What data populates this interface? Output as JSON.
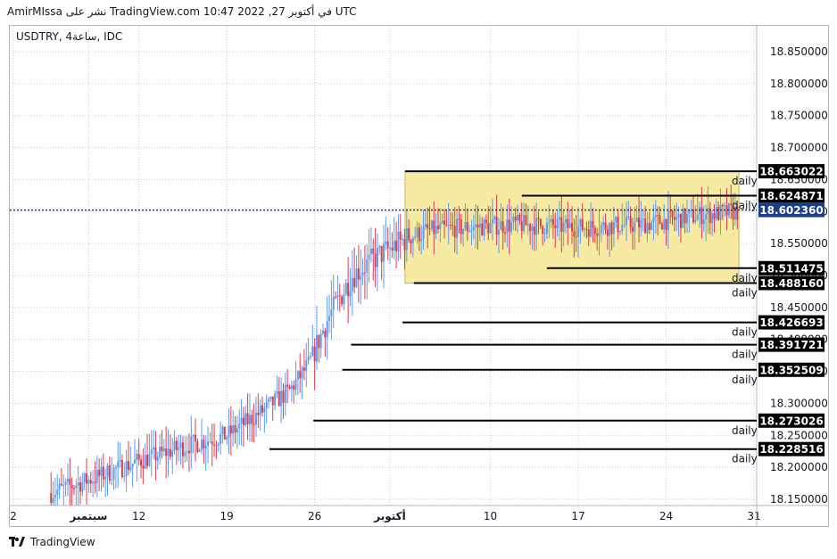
{
  "caption": "AmirMIssa نشر على TradingView.com في أكتوبر 27, 2022 10:47 UTC",
  "legend": "USDTRY, 4ساعة, IDC",
  "brand": "TradingView",
  "colors": {
    "up": "#5b9cf6",
    "down": "#e03a4d",
    "zone_fill": "#f7eaa2",
    "zone_border": "#c9b84f",
    "level_line": "#000000",
    "current_box": "#1b3e86",
    "grid": "#c5cad6"
  },
  "chart_data": {
    "type": "candlestick",
    "symbol": "USDTRY",
    "timeframe": "4ساعة",
    "source": "IDC",
    "y_axis": {
      "range": [
        18.15,
        18.88
      ],
      "ticks": [
        18.85,
        18.8,
        18.75,
        18.7,
        18.65,
        18.6,
        18.55,
        18.5,
        18.45,
        18.4,
        18.35,
        18.3,
        18.25,
        18.2,
        18.15
      ],
      "tick_labels": [
        "18.850000",
        "18.800000",
        "18.750000",
        "18.700000",
        "18.650000",
        "18.600000",
        "18.550000",
        "18.500000",
        "18.450000",
        "18.400000",
        "18.350000",
        "18.300000",
        "18.250000",
        "18.200000",
        "18.150000"
      ]
    },
    "x_axis": {
      "ticks": [
        {
          "label": "2",
          "day": 0
        },
        {
          "label": "سبتمبر",
          "day": 6
        },
        {
          "label": "12",
          "day": 10
        },
        {
          "label": "19",
          "day": 17
        },
        {
          "label": "26",
          "day": 24
        },
        {
          "label": "أكتوبر",
          "day": 30
        },
        {
          "label": "10",
          "day": 38
        },
        {
          "label": "17",
          "day": 45
        },
        {
          "label": "24",
          "day": 52
        },
        {
          "label": "31",
          "day": 59
        }
      ],
      "day_range": [
        0,
        60.5
      ]
    },
    "price_path": [
      {
        "day": 3.0,
        "price": 18.16
      },
      {
        "day": 6.0,
        "price": 18.18
      },
      {
        "day": 10.0,
        "price": 18.21
      },
      {
        "day": 14.0,
        "price": 18.235
      },
      {
        "day": 17.0,
        "price": 18.25
      },
      {
        "day": 20.0,
        "price": 18.29
      },
      {
        "day": 22.0,
        "price": 18.32
      },
      {
        "day": 23.5,
        "price": 18.36
      },
      {
        "day": 25.0,
        "price": 18.43
      },
      {
        "day": 27.0,
        "price": 18.5
      },
      {
        "day": 29.0,
        "price": 18.53
      },
      {
        "day": 31.5,
        "price": 18.56
      },
      {
        "day": 33.0,
        "price": 18.57
      },
      {
        "day": 36.0,
        "price": 18.575
      },
      {
        "day": 40.0,
        "price": 18.58
      },
      {
        "day": 45.0,
        "price": 18.575
      },
      {
        "day": 50.0,
        "price": 18.58
      },
      {
        "day": 55.0,
        "price": 18.595
      },
      {
        "day": 57.7,
        "price": 18.6
      }
    ],
    "consolidation_zone": {
      "day_start": 31.2,
      "day_end": 57.8,
      "price_top": 18.663022,
      "price_bottom": 18.48816
    },
    "current_price": {
      "value": 18.60236,
      "label": "18.602360"
    },
    "levels": [
      {
        "price": 18.663022,
        "label": "18.663022",
        "day_start": 31.2,
        "note": "daily",
        "note_pos": "below"
      },
      {
        "price": 18.624871,
        "label": "18.624871",
        "day_start": 40.5,
        "note": "daily",
        "note_pos": "below"
      },
      {
        "price": 18.511475,
        "label": "18.511475",
        "day_start": 42.5,
        "note": "daily",
        "note_pos": "below"
      },
      {
        "price": 18.48816,
        "label": "18.488160",
        "day_start": 31.9,
        "note": "daily",
        "note_pos": "below"
      },
      {
        "price": 18.426693,
        "label": "18.426693",
        "day_start": 31.0,
        "note": "daily",
        "note_pos": "below"
      },
      {
        "price": 18.391721,
        "label": "18.391721",
        "day_start": 26.9,
        "note": "daily",
        "note_pos": "below"
      },
      {
        "price": 18.352509,
        "label": "18.352509",
        "day_start": 26.2,
        "note": "daily",
        "note_pos": "below"
      },
      {
        "price": 18.273026,
        "label": "18.273026",
        "day_start": 23.9,
        "note": "daily",
        "note_pos": "below"
      },
      {
        "price": 18.228516,
        "label": "18.228516",
        "day_start": 20.4,
        "note": "daily",
        "note_pos": "below"
      }
    ]
  }
}
